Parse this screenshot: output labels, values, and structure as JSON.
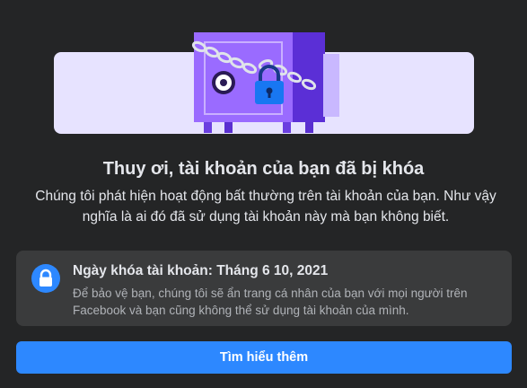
{
  "heading": "Thuy ơi, tài khoản của bạn đã bị khóa",
  "description": "Chúng tôi phát hiện hoạt động bất thường trên tài khoản của bạn. Như vậy nghĩa là ai đó đã sử dụng tài khoản này mà bạn không biết.",
  "notice": {
    "icon": "lock-icon",
    "title": "Ngày khóa tài khoản: Tháng 6 10, 2021",
    "text": "Để bảo vệ bạn, chúng tôi sẽ ẩn trang cá nhân của bạn với mọi người trên Facebook và bạn cũng không thể sử dụng tài khoản của mình."
  },
  "actions": {
    "learn_more_label": "Tìm hiểu thêm"
  },
  "colors": {
    "background": "#242526",
    "accent": "#2d88ff",
    "panel": "#3a3b3c",
    "banner": "#e7e3ff",
    "safe": "#9a6bff"
  },
  "illustration": {
    "icon": "locked-safe-illustration"
  }
}
